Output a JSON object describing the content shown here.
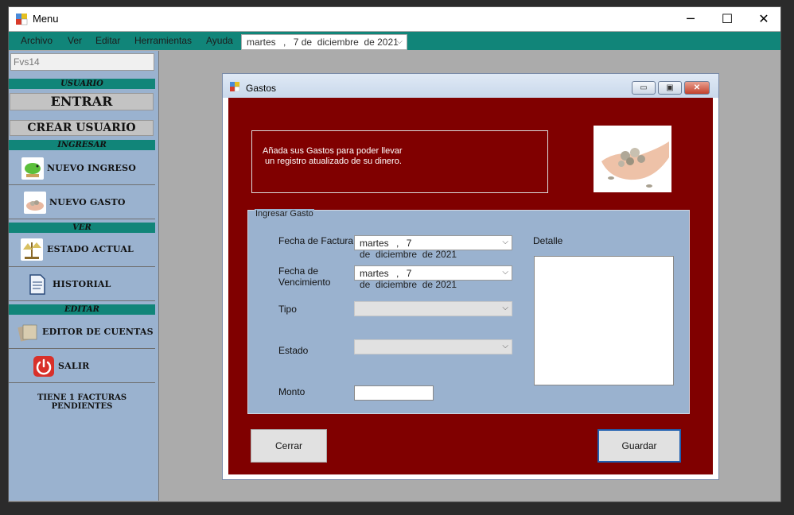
{
  "window": {
    "title": "Menu"
  },
  "menubar": {
    "items": [
      "Archivo",
      "Ver",
      "Editar",
      "Herramientas",
      "Ayuda"
    ],
    "date": {
      "weekday": "martes",
      "sep": ",",
      "day": "7",
      "rest": "de  diciembre  de 2021"
    }
  },
  "sidebar": {
    "user_value": "Fvs14",
    "sections": {
      "usuario": "USUARIO",
      "ingresar": "INGRESAR",
      "ver": "VER",
      "editar": "EDITAR"
    },
    "entrar": "ENTRAR",
    "crear_usuario": "CREAR USUARIO",
    "nuevo_ingreso": "NUEVO INGRESO",
    "nuevo_gasto": "NUEVO GASTO",
    "estado_actual": "ESTADO ACTUAL",
    "historial": "HISTORIAL",
    "editor_cuentas": "EDITOR DE CUENTAS",
    "salir": "SALIR",
    "pending": "TIENE 1 FACTURAS PENDIENTES"
  },
  "gastos": {
    "title": "Gastos",
    "intro": "Añada sus Gastos para poder llevar\n un registro atualizado de su dinero.",
    "group_title": "Ingresar Gasto",
    "fecha_factura_label": "Fecha de Factura",
    "fecha_venc_label": "Fecha de\nVencimiento",
    "tipo_label": "Tipo",
    "estado_label": "Estado",
    "monto_label": "Monto",
    "detalle_label": "Detalle",
    "fecha_factura": {
      "weekday": "martes",
      "sep": ",",
      "day": "7",
      "rest": "de  diciembre  de 2021"
    },
    "fecha_venc": {
      "weekday": "martes",
      "sep": ",",
      "day": "7",
      "rest": "de  diciembre  de 2021"
    },
    "cerrar": "Cerrar",
    "guardar": "Guardar"
  }
}
